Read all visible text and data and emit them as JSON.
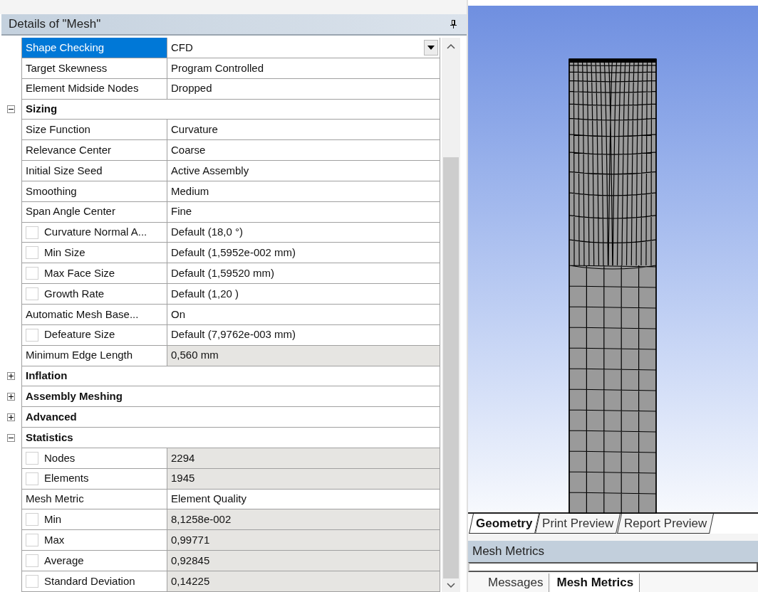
{
  "details_panel": {
    "title": "Details of \"Mesh\"",
    "rows": [
      {
        "kind": "property",
        "label": "Shape Checking",
        "value": "CFD",
        "selected": true,
        "readonly": false
      },
      {
        "kind": "property",
        "label": "Target Skewness",
        "value": "Program Controlled",
        "selected": false,
        "readonly": false
      },
      {
        "kind": "property",
        "label": "Element Midside Nodes",
        "value": "Dropped",
        "selected": false,
        "readonly": false
      },
      {
        "kind": "group",
        "label": "Sizing",
        "expanded": true,
        "selected": false
      },
      {
        "kind": "property",
        "label": "Size Function",
        "value": "Curvature",
        "selected": false,
        "readonly": false
      },
      {
        "kind": "property",
        "label": "Relevance Center",
        "value": "Coarse",
        "selected": false,
        "readonly": false
      },
      {
        "kind": "property",
        "label": "Initial Size Seed",
        "value": "Active Assembly",
        "selected": false,
        "readonly": false
      },
      {
        "kind": "property",
        "label": "Smoothing",
        "value": "Medium",
        "selected": false,
        "readonly": false
      },
      {
        "kind": "property",
        "label": "Span Angle Center",
        "value": "Fine",
        "selected": false,
        "readonly": false
      },
      {
        "kind": "option",
        "label": "Curvature Normal A...",
        "value": "Default (18,0 °)",
        "checked": false,
        "selected": false,
        "readonly": false
      },
      {
        "kind": "option",
        "label": "Min Size",
        "value": "Default (1,5952e-002 mm)",
        "checked": false,
        "selected": false,
        "readonly": false
      },
      {
        "kind": "option",
        "label": "Max Face Size",
        "value": "Default (1,59520 mm)",
        "checked": false,
        "selected": false,
        "readonly": false
      },
      {
        "kind": "option",
        "label": "Growth Rate",
        "value": "Default (1,20 )",
        "checked": false,
        "selected": false,
        "readonly": false
      },
      {
        "kind": "property",
        "label": "Automatic Mesh Base...",
        "value": "On",
        "selected": false,
        "readonly": false
      },
      {
        "kind": "option",
        "label": "Defeature Size",
        "value": "Default (7,9762e-003 mm)",
        "checked": false,
        "selected": false,
        "readonly": false
      },
      {
        "kind": "property",
        "label": "Minimum Edge Length",
        "value": "0,560 mm",
        "selected": false,
        "readonly": true
      },
      {
        "kind": "group",
        "label": "Inflation",
        "expanded": false,
        "selected": false
      },
      {
        "kind": "group",
        "label": "Assembly Meshing",
        "expanded": false,
        "selected": false
      },
      {
        "kind": "group",
        "label": "Advanced",
        "expanded": false,
        "selected": false
      },
      {
        "kind": "group",
        "label": "Statistics",
        "expanded": true,
        "selected": false
      },
      {
        "kind": "option",
        "label": "Nodes",
        "value": "2294",
        "checked": false,
        "selected": false,
        "readonly": true
      },
      {
        "kind": "option",
        "label": "Elements",
        "value": "1945",
        "checked": false,
        "selected": false,
        "readonly": true
      },
      {
        "kind": "property",
        "label": "Mesh Metric",
        "value": "Element Quality",
        "selected": false,
        "readonly": false
      },
      {
        "kind": "option",
        "label": "Min",
        "value": "8,1258e-002",
        "checked": false,
        "selected": false,
        "readonly": true
      },
      {
        "kind": "option",
        "label": "Max",
        "value": "0,99771",
        "checked": false,
        "selected": false,
        "readonly": true
      },
      {
        "kind": "option",
        "label": "Average",
        "value": "0,92845",
        "checked": false,
        "selected": false,
        "readonly": true
      },
      {
        "kind": "option",
        "label": "Standard Deviation",
        "value": "0,14225",
        "checked": false,
        "selected": false,
        "readonly": true
      }
    ]
  },
  "viewport_tabs": [
    {
      "label": "Geometry",
      "selected": true
    },
    {
      "label": "Print Preview",
      "selected": false
    },
    {
      "label": "Report Preview",
      "selected": false
    }
  ],
  "metrics_panel": {
    "title": "Mesh Metrics"
  },
  "bottom_tabs": [
    {
      "label": "Messages",
      "selected": false
    },
    {
      "label": "Mesh Metrics",
      "selected": true
    }
  ]
}
